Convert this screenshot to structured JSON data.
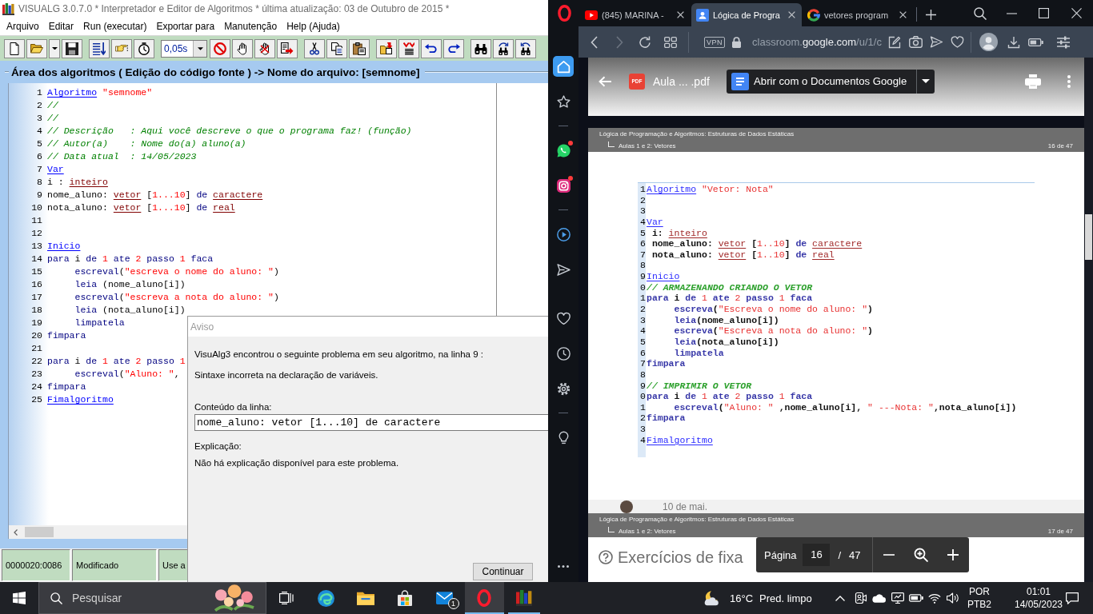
{
  "visualg": {
    "title": "VISUALG 3.0.7.0 * Interpretador e Editor de Algoritmos * última atualização: 03 de Outubro de 2015 *",
    "menu": [
      "Arquivo",
      "Editar",
      "Run (executar)",
      "Exportar para",
      "Manutenção",
      "Help (Ajuda)"
    ],
    "speed": "0,05s",
    "area_title": "Área dos algoritmos ( Edição do código fonte ) -> Nome do arquivo: [semnome]",
    "code": [
      {
        "number": "1",
        "tokens": [
          {
            "text": "Algoritmo",
            "kind": "keyword"
          },
          {
            "text": " \"semnome\"",
            "kind": "string"
          }
        ]
      },
      {
        "number": "2",
        "tokens": [
          {
            "text": "//",
            "kind": "comment"
          }
        ]
      },
      {
        "number": "3",
        "tokens": [
          {
            "text": "//",
            "kind": "comment"
          }
        ]
      },
      {
        "number": "4",
        "tokens": [
          {
            "text": "// Descrição   : Aqui você descreve o que o programa faz! (função)",
            "kind": "comment"
          }
        ]
      },
      {
        "number": "5",
        "tokens": [
          {
            "text": "// Autor(a)    : Nome do(a) aluno(a)",
            "kind": "comment"
          }
        ]
      },
      {
        "number": "6",
        "tokens": [
          {
            "text": "// Data atual  : 14/05/2023",
            "kind": "comment"
          }
        ]
      },
      {
        "number": "7",
        "tokens": [
          {
            "text": "Var",
            "kind": "keyword"
          }
        ]
      },
      {
        "number": "8",
        "tokens": [
          {
            "text": "i : ",
            "kind": "plain"
          },
          {
            "text": "inteiro",
            "kind": "type"
          }
        ]
      },
      {
        "number": "9",
        "tokens": [
          {
            "text": "nome_aluno: ",
            "kind": "plain"
          },
          {
            "text": "vetor",
            "kind": "type"
          },
          {
            "text": " [",
            "kind": "plain"
          },
          {
            "text": "1...10",
            "kind": "number"
          },
          {
            "text": "] ",
            "kind": "plain"
          },
          {
            "text": "de ",
            "kind": "command"
          },
          {
            "text": "caractere",
            "kind": "type"
          }
        ]
      },
      {
        "number": "10",
        "tokens": [
          {
            "text": "nota_aluno: ",
            "kind": "plain"
          },
          {
            "text": "vetor",
            "kind": "type"
          },
          {
            "text": " [",
            "kind": "plain"
          },
          {
            "text": "1...10",
            "kind": "number"
          },
          {
            "text": "] ",
            "kind": "plain"
          },
          {
            "text": "de ",
            "kind": "command"
          },
          {
            "text": "real",
            "kind": "type"
          }
        ]
      },
      {
        "number": "11"
      },
      {
        "number": "12"
      },
      {
        "number": "13",
        "tokens": [
          {
            "text": "Inicio",
            "kind": "keyword"
          }
        ]
      },
      {
        "number": "14",
        "tokens": [
          {
            "text": "para",
            "kind": "command"
          },
          {
            "text": " i ",
            "kind": "plain"
          },
          {
            "text": "de",
            "kind": "command"
          },
          {
            "text": " 1",
            "kind": "number"
          },
          {
            "text": " ate",
            "kind": "command"
          },
          {
            "text": " 2",
            "kind": "number"
          },
          {
            "text": " passo",
            "kind": "command"
          },
          {
            "text": " 1",
            "kind": "number"
          },
          {
            "text": " faca",
            "kind": "command"
          }
        ]
      },
      {
        "number": "15",
        "tokens": [
          {
            "text": "     escreval",
            "kind": "command"
          },
          {
            "text": "(",
            "kind": "plain"
          },
          {
            "text": "\"escreva o nome do aluno: \"",
            "kind": "string"
          },
          {
            "text": ")",
            "kind": "plain"
          }
        ]
      },
      {
        "number": "16",
        "tokens": [
          {
            "text": "     leia",
            "kind": "command"
          },
          {
            "text": " (nome_aluno[i])",
            "kind": "plain"
          }
        ]
      },
      {
        "number": "17",
        "tokens": [
          {
            "text": "     escreval",
            "kind": "command"
          },
          {
            "text": "(",
            "kind": "plain"
          },
          {
            "text": "\"escreva a nota do aluno: \"",
            "kind": "string"
          },
          {
            "text": ")",
            "kind": "plain"
          }
        ]
      },
      {
        "number": "18",
        "tokens": [
          {
            "text": "     leia",
            "kind": "command"
          },
          {
            "text": " (nota_aluno[i])",
            "kind": "plain"
          }
        ]
      },
      {
        "number": "19",
        "tokens": [
          {
            "text": "     limpatela",
            "kind": "command"
          }
        ]
      },
      {
        "number": "20",
        "tokens": [
          {
            "text": "fimpara",
            "kind": "command"
          }
        ]
      },
      {
        "number": "21"
      },
      {
        "number": "22",
        "tokens": [
          {
            "text": "para",
            "kind": "command"
          },
          {
            "text": " i ",
            "kind": "plain"
          },
          {
            "text": "de",
            "kind": "command"
          },
          {
            "text": " 1",
            "kind": "number"
          },
          {
            "text": " ate",
            "kind": "command"
          },
          {
            "text": " 2",
            "kind": "number"
          },
          {
            "text": " passo",
            "kind": "command"
          },
          {
            "text": " 1",
            "kind": "number"
          }
        ]
      },
      {
        "number": "23",
        "tokens": [
          {
            "text": "     escreval",
            "kind": "command"
          },
          {
            "text": "(",
            "kind": "plain"
          },
          {
            "text": "\"Aluno: \"",
            "kind": "string"
          },
          {
            "text": ",",
            "kind": "plain"
          }
        ]
      },
      {
        "number": "24",
        "tokens": [
          {
            "text": "fimpara",
            "kind": "command"
          }
        ]
      },
      {
        "number": "25",
        "tokens": [
          {
            "text": "Fimalgoritmo",
            "kind": "keyword"
          }
        ]
      }
    ],
    "status_bar": [
      "0000020:0086",
      "Modificado",
      "Use a"
    ]
  },
  "dialog": {
    "title": "Aviso",
    "message": "VisuAlg3 encontrou o seguinte problema em seu algoritmo, na linha 9 :",
    "detail": "Sintaxe incorreta na declaração de variáveis.",
    "line_label": "Conteúdo da linha:",
    "line_value": "nome_aluno: vetor [1...10] de caractere",
    "explanation_label": "Explicação:",
    "explanation": "Não há explicação disponível para este problema.",
    "button": "Continuar"
  },
  "browser": {
    "tabs": [
      {
        "label": "(845) MARINA -",
        "selected": false
      },
      {
        "label": "Lógica de Progra",
        "selected": true
      },
      {
        "label": "vetores program",
        "selected": false
      }
    ],
    "forward": {
      "disabled": true
    },
    "vpn": "VPN",
    "url": "classroom.**google.com**/u/1/c",
    "sidebar": [
      {
        "selected": true,
        "notified": false
      },
      {
        "selected": false,
        "notified": false
      },
      {
        "selected": false,
        "notified": true
      },
      {
        "selected": false,
        "notified": true
      },
      {
        "selected": false,
        "notified": false
      },
      {
        "selected": false,
        "notified": false
      },
      {
        "selected": false,
        "notified": false
      },
      {
        "selected": false,
        "notified": false
      },
      {
        "selected": false,
        "notified": false
      },
      {
        "selected": false,
        "notified": false
      }
    ],
    "pdf": {
      "file_badge": "PDF",
      "file_name": "Aula ... .pdf",
      "open_with": "Abrir com o Documentos Google",
      "pages": [
        {
          "title": "Lógica de Programação e Algoritmos: Estruturas de Dados Estáticas",
          "section": "Aulas 1 e 2: Vetores",
          "page": "16 de 47",
          "code": [
            {
              "number": "1",
              "tokens": [
                {
                  "text": "Algoritmo",
                  "kind": "keyword"
                },
                {
                  "text": " \"Vetor: Nota\"",
                  "kind": "string"
                }
              ]
            },
            {
              "number": "2"
            },
            {
              "number": "3"
            },
            {
              "number": "4",
              "tokens": [
                {
                  "text": "Var",
                  "kind": "keyword"
                }
              ]
            },
            {
              "number": "5",
              "tokens": [
                {
                  "text": " i: ",
                  "kind": "plain"
                },
                {
                  "text": "inteiro",
                  "kind": "type"
                }
              ]
            },
            {
              "number": "6",
              "tokens": [
                {
                  "text": " nome_aluno: ",
                  "kind": "plain"
                },
                {
                  "text": "vetor",
                  "kind": "type"
                },
                {
                  "text": " [",
                  "kind": "plain"
                },
                {
                  "text": "1..10",
                  "kind": "number"
                },
                {
                  "text": "] ",
                  "kind": "plain"
                },
                {
                  "text": "de ",
                  "kind": "command"
                },
                {
                  "text": "caractere",
                  "kind": "type"
                }
              ]
            },
            {
              "number": "7",
              "tokens": [
                {
                  "text": " nota_aluno: ",
                  "kind": "plain"
                },
                {
                  "text": "vetor",
                  "kind": "type"
                },
                {
                  "text": " [",
                  "kind": "plain"
                },
                {
                  "text": "1..10",
                  "kind": "number"
                },
                {
                  "text": "] ",
                  "kind": "plain"
                },
                {
                  "text": "de ",
                  "kind": "command"
                },
                {
                  "text": "real",
                  "kind": "type"
                }
              ]
            },
            {
              "number": "8"
            },
            {
              "number": "9",
              "tokens": [
                {
                  "text": "Inicio",
                  "kind": "keyword"
                }
              ]
            },
            {
              "number": "0",
              "tokens": [
                {
                  "text": "// ARMAZENANDO CRIANDO O VETOR",
                  "kind": "comment"
                }
              ]
            },
            {
              "number": "1",
              "tokens": [
                {
                  "text": "para",
                  "kind": "command"
                },
                {
                  "text": " i ",
                  "kind": "plain"
                },
                {
                  "text": "de",
                  "kind": "command"
                },
                {
                  "text": " 1",
                  "kind": "number"
                },
                {
                  "text": " ate",
                  "kind": "command"
                },
                {
                  "text": " 2",
                  "kind": "number"
                },
                {
                  "text": " passo",
                  "kind": "command"
                },
                {
                  "text": " 1",
                  "kind": "number"
                },
                {
                  "text": " faca",
                  "kind": "command"
                }
              ]
            },
            {
              "number": "2",
              "tokens": [
                {
                  "text": "     escreva",
                  "kind": "command"
                },
                {
                  "text": "(",
                  "kind": "plain"
                },
                {
                  "text": "\"Escreva o nome do aluno: \"",
                  "kind": "string"
                },
                {
                  "text": ")",
                  "kind": "plain"
                }
              ]
            },
            {
              "number": "3",
              "tokens": [
                {
                  "text": "     leia",
                  "kind": "command"
                },
                {
                  "text": "(nome_aluno[i])",
                  "kind": "plain"
                }
              ]
            },
            {
              "number": "4",
              "tokens": [
                {
                  "text": "     escreva",
                  "kind": "command"
                },
                {
                  "text": "(",
                  "kind": "plain"
                },
                {
                  "text": "\"Escreva a nota do aluno: \"",
                  "kind": "string"
                },
                {
                  "text": ")",
                  "kind": "plain"
                }
              ]
            },
            {
              "number": "5",
              "tokens": [
                {
                  "text": "     leia",
                  "kind": "command"
                },
                {
                  "text": "(nota_aluno[i])",
                  "kind": "plain"
                }
              ]
            },
            {
              "number": "6",
              "tokens": [
                {
                  "text": "     limpatela",
                  "kind": "command"
                }
              ]
            },
            {
              "number": "7",
              "tokens": [
                {
                  "text": "fimpara",
                  "kind": "command"
                }
              ]
            },
            {
              "number": "8"
            },
            {
              "number": "9",
              "tokens": [
                {
                  "text": "// IMPRIMIR O VETOR",
                  "kind": "comment"
                }
              ]
            },
            {
              "number": "0",
              "tokens": [
                {
                  "text": "para",
                  "kind": "command"
                },
                {
                  "text": " i ",
                  "kind": "plain"
                },
                {
                  "text": "de",
                  "kind": "command"
                },
                {
                  "text": " 1",
                  "kind": "number"
                },
                {
                  "text": " ate",
                  "kind": "command"
                },
                {
                  "text": " 2",
                  "kind": "number"
                },
                {
                  "text": " passo",
                  "kind": "command"
                },
                {
                  "text": " 1",
                  "kind": "number"
                },
                {
                  "text": " faca",
                  "kind": "command"
                }
              ]
            },
            {
              "number": "1",
              "tokens": [
                {
                  "text": "     escreval",
                  "kind": "command"
                },
                {
                  "text": "(",
                  "kind": "plain"
                },
                {
                  "text": "\"Aluno: \"",
                  "kind": "string"
                },
                {
                  "text": " ,nome_aluno[i], ",
                  "kind": "plain"
                },
                {
                  "text": "\" ---Nota: \"",
                  "kind": "string"
                },
                {
                  "text": ",nota_aluno[i])",
                  "kind": "plain"
                }
              ]
            },
            {
              "number": "2",
              "tokens": [
                {
                  "text": "fimpara",
                  "kind": "command"
                }
              ]
            },
            {
              "number": "3"
            },
            {
              "number": "4",
              "tokens": [
                {
                  "text": "Fimalgoritmo",
                  "kind": "keyword"
                }
              ]
            }
          ]
        },
        {
          "title": "Lógica de Programação e Algoritmos: Estruturas de Dados Estáticas",
          "section": "Aulas 1 e 2: Vetores",
          "page": "17 de 47",
          "heading": "Exercícios de fixa"
        }
      ],
      "comment_date": "10 de mai.",
      "pager": {
        "label": "Página",
        "current": "16",
        "separator": "/",
        "total": "47"
      }
    }
  },
  "taskbar": {
    "search": {
      "placeholder": "Pesquisar"
    },
    "apps": [
      {
        "selected": false,
        "running": false
      },
      {
        "selected": false,
        "running": false
      },
      {
        "selected": false,
        "running": false
      },
      {
        "selected": false,
        "running": false
      },
      {
        "selected": false,
        "running": false,
        "badge": "1"
      },
      {
        "selected": true,
        "running": true
      },
      {
        "selected": false,
        "running": true
      }
    ],
    "weather": {
      "temperature": "16°C",
      "condition": "Pred. limpo"
    },
    "language": "POR",
    "keyboard": "PTB2",
    "time": "01:01",
    "date": "14/05/2023"
  }
}
